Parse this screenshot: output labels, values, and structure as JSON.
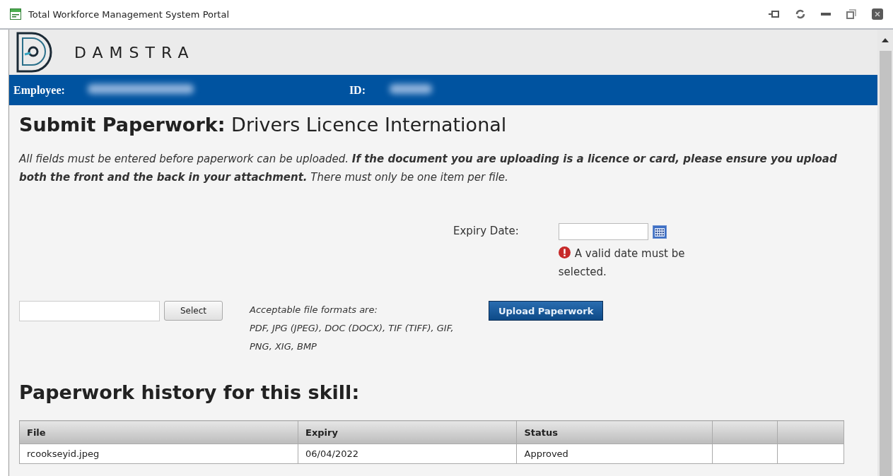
{
  "window": {
    "title": "Total Workforce Management System Portal"
  },
  "brand": {
    "name": "DAMSTRA"
  },
  "employee_bar": {
    "employee_label": "Employee:",
    "id_label": "ID:"
  },
  "heading": {
    "bold": "Submit Paperwork:",
    "rest": "Drivers Licence International"
  },
  "intro": "All fields must be entered before paperwork can be uploaded. **If the document you are uploading is a licence or card, please ensure you upload both the front and the back in your attachment.** There must only be one item per file.",
  "expiry": {
    "label": "Expiry Date:",
    "error": "A valid date must be selected."
  },
  "file": {
    "button": "Select",
    "formats_title": "Acceptable file formats are:",
    "formats": "PDF, JPG (JPEG), DOC (DOCX), TIF (TIFF), GIF, PNG, XIG, BMP"
  },
  "upload_button": "Upload Paperwork",
  "history": {
    "title": "Paperwork history for this skill:",
    "columns": [
      {
        "label": "File"
      },
      {
        "label": "Expiry"
      },
      {
        "label": "Status"
      },
      {},
      {}
    ],
    "rows": [
      {
        "cells": [
          "rcookseyid.jpeg",
          "06/04/2022",
          "Approved"
        ]
      }
    ]
  }
}
